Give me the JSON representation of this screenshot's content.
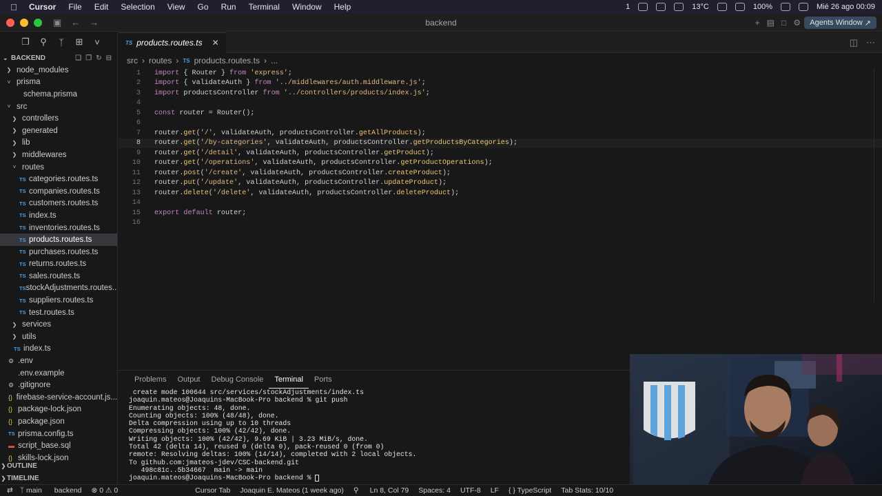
{
  "menubar": {
    "app": "Cursor",
    "items": [
      "File",
      "Edit",
      "Selection",
      "View",
      "Go",
      "Run",
      "Terminal",
      "Window",
      "Help"
    ],
    "notifications": "1",
    "temperature": "13°C",
    "battery": "100%",
    "datetime": "Mié 26 ago  00:09"
  },
  "window": {
    "title": "backend",
    "agents_button": "Agents Window"
  },
  "sidebar": {
    "header": "BACKEND",
    "tree": [
      {
        "label": "node_modules",
        "type": "folder",
        "indent": 0,
        "open": false
      },
      {
        "label": "prisma",
        "type": "folder",
        "indent": 0,
        "open": true
      },
      {
        "label": "schema.prisma",
        "type": "file-prisma",
        "indent": 1
      },
      {
        "label": "src",
        "type": "folder",
        "indent": 0,
        "open": true
      },
      {
        "label": "controllers",
        "type": "folder",
        "indent": 1,
        "open": false
      },
      {
        "label": "generated",
        "type": "folder",
        "indent": 1,
        "open": false
      },
      {
        "label": "lib",
        "type": "folder",
        "indent": 1,
        "open": false
      },
      {
        "label": "middlewares",
        "type": "folder",
        "indent": 1,
        "open": false
      },
      {
        "label": "routes",
        "type": "folder",
        "indent": 1,
        "open": true
      },
      {
        "label": "categories.routes.ts",
        "type": "ts",
        "indent": 2
      },
      {
        "label": "companies.routes.ts",
        "type": "ts",
        "indent": 2
      },
      {
        "label": "customers.routes.ts",
        "type": "ts",
        "indent": 2
      },
      {
        "label": "index.ts",
        "type": "ts",
        "indent": 2
      },
      {
        "label": "inventories.routes.ts",
        "type": "ts",
        "indent": 2
      },
      {
        "label": "products.routes.ts",
        "type": "ts",
        "indent": 2,
        "selected": true
      },
      {
        "label": "purchases.routes.ts",
        "type": "ts",
        "indent": 2
      },
      {
        "label": "returns.routes.ts",
        "type": "ts",
        "indent": 2
      },
      {
        "label": "sales.routes.ts",
        "type": "ts",
        "indent": 2
      },
      {
        "label": "stockAdjustments.routes...",
        "type": "ts",
        "indent": 2
      },
      {
        "label": "suppliers.routes.ts",
        "type": "ts",
        "indent": 2
      },
      {
        "label": "test.routes.ts",
        "type": "ts",
        "indent": 2
      },
      {
        "label": "services",
        "type": "folder",
        "indent": 1,
        "open": false
      },
      {
        "label": "utils",
        "type": "folder",
        "indent": 1,
        "open": false
      },
      {
        "label": "index.ts",
        "type": "ts",
        "indent": 1
      },
      {
        "label": ".env",
        "type": "gear",
        "indent": 0
      },
      {
        "label": ".env.example",
        "type": "plain",
        "indent": 0
      },
      {
        "label": ".gitignore",
        "type": "gear",
        "indent": 0
      },
      {
        "label": "firebase-service-account.js...",
        "type": "json",
        "indent": 0
      },
      {
        "label": "package-lock.json",
        "type": "json",
        "indent": 0
      },
      {
        "label": "package.json",
        "type": "json",
        "indent": 0
      },
      {
        "label": "prisma.config.ts",
        "type": "ts",
        "indent": 0
      },
      {
        "label": "script_base.sql",
        "type": "sql",
        "indent": 0
      },
      {
        "label": "skills-lock.json",
        "type": "json",
        "indent": 0
      }
    ],
    "outline": "OUTLINE",
    "timeline": "TIMELINE"
  },
  "editor": {
    "tab": "products.routes.ts",
    "breadcrumb": [
      "src",
      "routes",
      "products.routes.ts",
      "..."
    ],
    "cursor_line": 8,
    "lines": [
      "import { Router } from 'express';",
      "import { validateAuth } from '../middlewares/auth.middleware.js';",
      "import productsController from '../controllers/products/index.js';",
      "",
      "const router = Router();",
      "",
      "router.get('/', validateAuth, productsController.getAllProducts);",
      "router.get('/by-categories', validateAuth, productsController.getProductsByCategories);",
      "router.get('/detail', validateAuth, productsController.getProduct);",
      "router.get('/operations', validateAuth, productsController.getProductOperations);",
      "router.post('/create', validateAuth, productsController.createProduct);",
      "router.put('/update', validateAuth, productsController.updateProduct);",
      "router.delete('/delete', validateAuth, productsController.deleteProduct);",
      "",
      "export default router;",
      ""
    ]
  },
  "panel": {
    "tabs": [
      "Problems",
      "Output",
      "Debug Console",
      "Terminal",
      "Ports"
    ],
    "active_tab": "Terminal",
    "terminal_lines": [
      " create mode 100644 src/services/stockAdjustments/index.ts",
      "joaquin.mateos@Joaquins-MacBook-Pro backend % git push",
      "Enumerating objects: 48, done.",
      "Counting objects: 100% (48/48), done.",
      "Delta compression using up to 10 threads",
      "Compressing objects: 100% (42/42), done.",
      "Writing objects: 100% (42/42), 9.69 KiB | 3.23 MiB/s, done.",
      "Total 42 (delta 14), reused 0 (delta 0), pack-reused 0 (from 0)",
      "remote: Resolving deltas: 100% (14/14), completed with 2 local objects.",
      "To github.com:jmateos-jdev/CSC-backend.git",
      "   498c81c..5b34667  main -> main"
    ],
    "prompt": "joaquin.mateos@Joaquins-MacBook-Pro backend % "
  },
  "statusbar": {
    "branch": "main",
    "project": "backend",
    "errors": "0",
    "warnings": "0",
    "cursor_tab": "Cursor Tab",
    "blame": "Joaquin E. Mateos (1 week ago)",
    "position": "Ln 8, Col 79",
    "spaces": "Spaces: 4",
    "encoding": "UTF-8",
    "eol": "LF",
    "language": "TypeScript",
    "tab_stats": "Tab Stats: 10/10"
  }
}
